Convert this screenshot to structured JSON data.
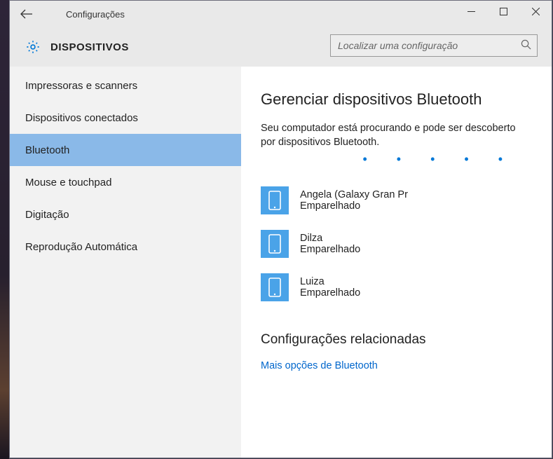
{
  "titlebar": {
    "title": "Configurações"
  },
  "header": {
    "section": "DISPOSITIVOS",
    "search_placeholder": "Localizar uma configuração"
  },
  "sidebar": {
    "items": [
      {
        "label": "Impressoras e scanners",
        "selected": false
      },
      {
        "label": "Dispositivos conectados",
        "selected": false
      },
      {
        "label": "Bluetooth",
        "selected": true
      },
      {
        "label": "Mouse e touchpad",
        "selected": false
      },
      {
        "label": "Digitação",
        "selected": false
      },
      {
        "label": "Reprodução Automática",
        "selected": false
      }
    ]
  },
  "content": {
    "title": "Gerenciar dispositivos Bluetooth",
    "description": "Seu computador está procurando e pode ser descoberto por dispositivos Bluetooth.",
    "devices": [
      {
        "name": "Angela (Galaxy Gran Pr",
        "status": "Emparelhado"
      },
      {
        "name": "Dilza",
        "status": "Emparelhado"
      },
      {
        "name": "Luiza",
        "status": "Emparelhado"
      }
    ],
    "related_title": "Configurações relacionadas",
    "related_link": "Mais opções de Bluetooth"
  }
}
